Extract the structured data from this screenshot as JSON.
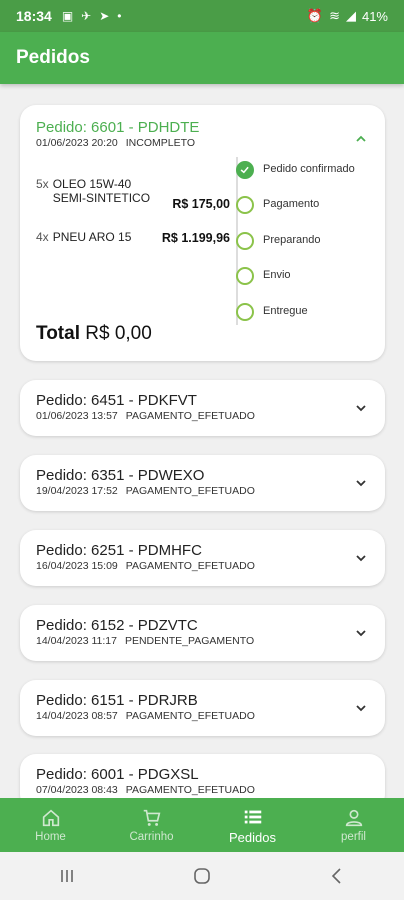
{
  "status_bar": {
    "time": "18:34",
    "battery": "41%"
  },
  "app_bar": {
    "title": "Pedidos"
  },
  "expanded_order": {
    "title": "Pedido: 6601 - PDHDTE",
    "date": "01/06/2023 20:20",
    "status": "INCOMPLETO",
    "items": [
      {
        "qty": "5x",
        "name_line1": "OLEO 15W-40",
        "name_line2": "SEMI-SINTETICO",
        "price": "R$ 175,00"
      },
      {
        "qty": "4x",
        "name_line1": "PNEU ARO 15",
        "name_line2": "",
        "price": "R$ 1.199,96"
      }
    ],
    "total_label": "Total",
    "total_value": "R$ 0,00",
    "steps": [
      {
        "label": "Pedido confirmado",
        "done": true
      },
      {
        "label": "Pagamento",
        "done": false
      },
      {
        "label": "Preparando",
        "done": false
      },
      {
        "label": "Envio",
        "done": false
      },
      {
        "label": "Entregue",
        "done": false
      }
    ]
  },
  "orders": [
    {
      "title": "Pedido: 6451 - PDKFVT",
      "date": "01/06/2023 13:57",
      "status": "PAGAMENTO_EFETUADO"
    },
    {
      "title": "Pedido: 6351 - PDWEXO",
      "date": "19/04/2023 17:52",
      "status": "PAGAMENTO_EFETUADO"
    },
    {
      "title": "Pedido: 6251 - PDMHFC",
      "date": "16/04/2023 15:09",
      "status": "PAGAMENTO_EFETUADO"
    },
    {
      "title": "Pedido: 6152 - PDZVTC",
      "date": "14/04/2023 11:17",
      "status": "PENDENTE_PAGAMENTO"
    },
    {
      "title": "Pedido: 6151 - PDRJRB",
      "date": "14/04/2023 08:57",
      "status": "PAGAMENTO_EFETUADO"
    },
    {
      "title": "Pedido: 6001 - PDGXSL",
      "date": "07/04/2023 08:43",
      "status": "PAGAMENTO_EFETUADO"
    }
  ],
  "bottom_nav": {
    "home": "Home",
    "cart": "Carrinho",
    "orders": "Pedidos",
    "profile": "perfil"
  },
  "colors": {
    "primary": "#4caf50",
    "status_bar": "#4a9d47"
  }
}
